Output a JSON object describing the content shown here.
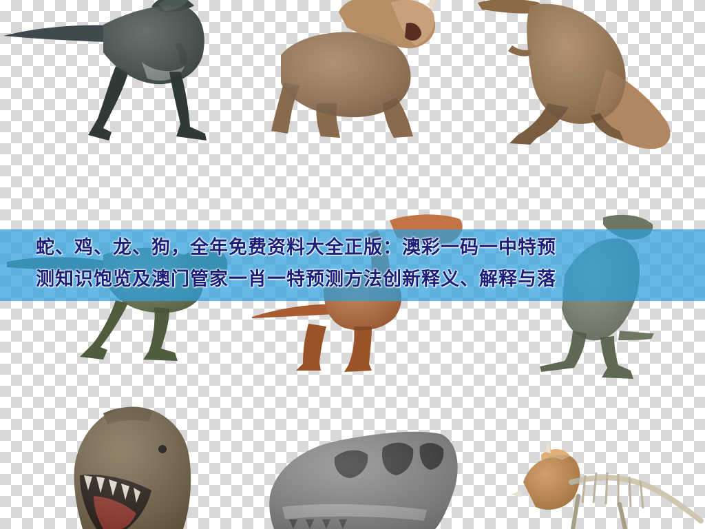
{
  "headline": {
    "line1": "蛇、鸡、龙、狗，全年免费资料大全正版：澳彩一码一中特预",
    "line2": "测知识饱览及澳门管家一肖一特预测方法创新释义、解释与落"
  },
  "figures": [
    "raptor-icon",
    "triceratops-calf-icon",
    "brown-tyrannosaurus-icon",
    "olive-theropod-icon",
    "orange-theropod-icon",
    "grey-green-theropod-icon",
    "tyrannosaurus-head-icon",
    "tyrannosaurus-skull-icon",
    "triceratops-skeleton-icon"
  ],
  "colors": {
    "checker_light": "#ffffff",
    "checker_dark": "#d9d9d9",
    "banner": "#2ca0de",
    "headline_text": "#1c1f7a"
  }
}
